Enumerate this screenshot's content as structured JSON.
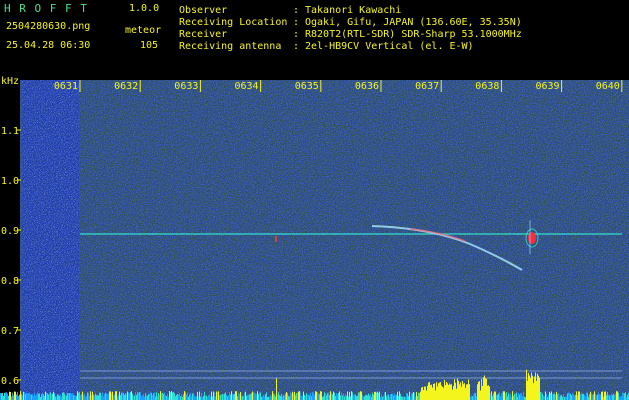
{
  "app": {
    "name": "H R O F F T",
    "version": "1.0.0"
  },
  "file": {
    "name": "2504280630.png",
    "datetime": "25.04.28 06:30"
  },
  "detection": {
    "label": "meteor",
    "count": "105"
  },
  "info": [
    {
      "key": "Observer",
      "sep": ":",
      "value": "Takanori Kawachi"
    },
    {
      "key": "Receiving Location",
      "sep": ":",
      "value": "Ogaki, Gifu, JAPAN (136.60E, 35.35N)"
    },
    {
      "key": "Receiver",
      "sep": ":",
      "value": "R820T2(RTL-SDR) SDR-Sharp 53.1000MHz"
    },
    {
      "key": "Receiving antenna",
      "sep": ":",
      "value": "2el-HB9CV Vertical (el. E-W)"
    }
  ],
  "axes": {
    "y_unit": "kHz",
    "y_ticks": [
      "1.1",
      "1.0",
      "0.9",
      "0.8",
      "0.7",
      "0.6"
    ],
    "x_ticks": [
      "0631",
      "0632",
      "0633",
      "0634",
      "0635",
      "0636",
      "0637",
      "0638",
      "0639",
      "0640"
    ]
  },
  "colors": {
    "header_text": "#f5f51e",
    "app_name": "#44e08a",
    "background": "#000000",
    "spectrum_base": "#000a8c",
    "carrier_line": "#2fe0d0",
    "meteor_trail": "#9ad8f5",
    "meteor_head": "#ff2a3a"
  }
}
